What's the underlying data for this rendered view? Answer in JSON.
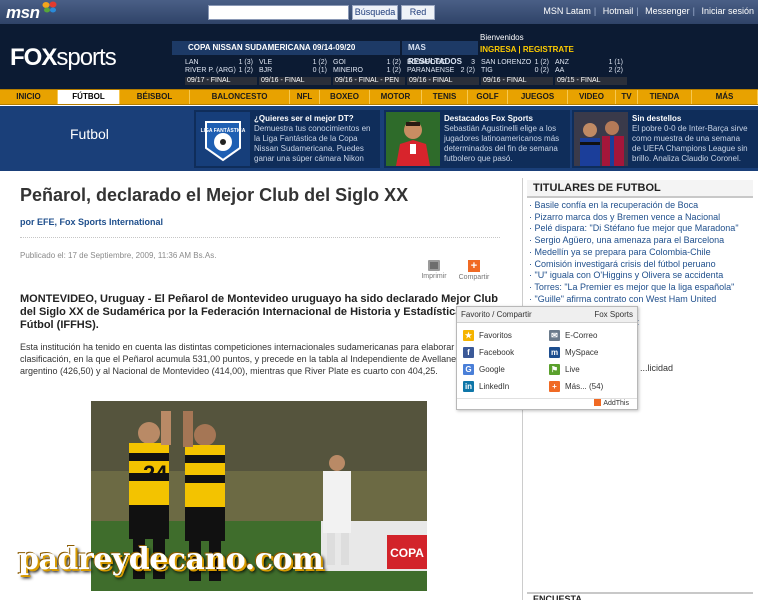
{
  "msn": {
    "logo": "msn",
    "search_value": "",
    "search_button": "Búsqueda",
    "web_button": "Red",
    "links": [
      "MSN Latam",
      "Hotmail",
      "Messenger",
      "Iniciar sesión"
    ]
  },
  "header": {
    "logo_fox": "FOX",
    "logo_sports": "sports",
    "ticker_title": "COPA NISSAN SUDAMERICANA 09/14-09/20",
    "ticker_more": "MAS RESULTADOS",
    "welcome": "Bienvenidos",
    "signup": "INGRESA",
    "register": "REGISTRATE",
    "scores": [
      {
        "t1": "LAN",
        "s1": "1 (3)",
        "t2": "RIVER P. (ARG)",
        "s2": "1 (2)",
        "status": "09/17 - FINAL"
      },
      {
        "t1": "VLE",
        "s1": "1 (2)",
        "t2": "BJR",
        "s2": "0 (1)",
        "status": "09/16 - FINAL"
      },
      {
        "t1": "GOI",
        "s1": "1 (2)",
        "t2": "MINEIRO",
        "s2": "1 (2)",
        "status": "09/16 - FINAL - PEN"
      },
      {
        "t1": "BOTAFOGO",
        "s1": "3",
        "t2": "PARANAENSE",
        "s2": "2 (2)",
        "status": "09/16 - FINAL"
      },
      {
        "t1": "SAN LORENZO",
        "s1": "1 (2)",
        "t2": "TIG",
        "s2": "0 (2)",
        "status": "09/16 - FINAL"
      },
      {
        "t1": "ANZ",
        "s1": "1 (1)",
        "t2": "AA",
        "s2": "2 (2)",
        "status": "09/15 - FINAL"
      }
    ]
  },
  "nav": [
    {
      "label": "INICIO",
      "w": 58
    },
    {
      "label": "FÚTBOL",
      "w": 62
    },
    {
      "label": "BÉISBOL",
      "w": 70
    },
    {
      "label": "BALONCESTO",
      "w": 100
    },
    {
      "label": "NFL",
      "w": 30
    },
    {
      "label": "BOXEO",
      "w": 50
    },
    {
      "label": "MOTOR",
      "w": 52
    },
    {
      "label": "TENIS",
      "w": 46
    },
    {
      "label": "GOLF",
      "w": 40
    },
    {
      "label": "JUEGOS",
      "w": 60
    },
    {
      "label": "VIDEO",
      "w": 48
    },
    {
      "label": "TV",
      "w": 22
    },
    {
      "label": "TIENDA",
      "w": 54
    },
    {
      "label": "MÁS",
      "w": 66
    }
  ],
  "promo": {
    "section_title": "Futbol",
    "cards": [
      {
        "title": "¿Quieres ser el mejor DT?",
        "text": "Demuestra tus conocimientos en la Liga Fantástica de la Copa Nissan Sudamericana. Puedes ganar una súper cámara Nikon",
        "img_label": "LIGA FANTÁSTICA"
      },
      {
        "title": "Destacados Fox Sports",
        "text": "Sebastián Agustinelli elige a los jugadores latinoamericanos más determinados del fin de semana futbolero que pasó."
      },
      {
        "title": "Sin destellos",
        "text": "El pobre 0-0 de Inter-Barça sirve como muestra de una semana de UEFA Champions League sin brillo. Analiza Claudio Coronel."
      }
    ]
  },
  "article": {
    "headline": "Peñarol, declarado el Mejor Club del Siglo XX",
    "byline": "por EFE, Fox Sports International",
    "published": "Publicado el: 17 de Septiembre, 2009, 11:36 AM Bs.As.",
    "print_label": "Imprimir",
    "share_label": "Compartir",
    "lead": "MONTEVIDEO, Uruguay - El Peñarol de Montevideo uruguayo ha sido declarado Mejor Club del Siglo XX de Sudamérica por la Federación Internacional de Historia y Estadística de Fútbol (IFFHS).",
    "body": "Esta institución ha tenido en cuenta las distintas competiciones internacionales sudamericanas para elaborar la clasificación, en la que el Peñarol acumula 531,00 puntos, y precede en la tabla al Independiente de Avellaneda argentino (426,50) y al Nacional de Montevideo (414,00), mientras que River Plate es cuarto con 404,25.",
    "jersey_number": "24",
    "sponsor": "COPA"
  },
  "watermark": "padreydecano.com",
  "sidebar": {
    "title": "TITULARES DE FUTBOL",
    "items": [
      "Basile confía en la recuperación de Boca",
      "Pizarro marca dos y Bremen vence a Nacional",
      "Pelé dispara: \"Di Stéfano fue mejor que Maradona\"",
      "Sergio Agüero, una amenaza para el Barcelona",
      "Medellín ya se prepara para Colombia-Chile",
      "Comisión investigará crisis del fútbol peruano",
      "\"U\" iguala con O'Higgins y Olivera se accidenta",
      "Torres: \"La Premier es mejor que la liga española\"",
      "\"Guille\" afirma contrato con West Ham United",
      "...emis en Copa Colombia",
      "...blos y saldría Rodríguez",
      "...r Club del Siglo XX"
    ],
    "box2_text": "...licidad",
    "bottom_title": "ENCUESTA"
  },
  "share_popup": {
    "title": "Favorito / Compartir",
    "brand": "Fox Sports",
    "items": [
      {
        "label": "Favoritos",
        "icon": "star-icon",
        "color": "#f5b400",
        "glyph": "★"
      },
      {
        "label": "E-Correo",
        "icon": "email-icon",
        "color": "#6b7b8c",
        "glyph": "✉"
      },
      {
        "label": "Facebook",
        "icon": "facebook-icon",
        "color": "#3b5998",
        "glyph": "f"
      },
      {
        "label": "MySpace",
        "icon": "myspace-icon",
        "color": "#1d4e8f",
        "glyph": "m"
      },
      {
        "label": "Google",
        "icon": "google-icon",
        "color": "#4a7fd8",
        "glyph": "G"
      },
      {
        "label": "Live",
        "icon": "live-icon",
        "color": "#5aa02c",
        "glyph": "⚑"
      },
      {
        "label": "LinkedIn",
        "icon": "linkedin-icon",
        "color": "#0e76a8",
        "glyph": "in"
      },
      {
        "label": "Más... (54)",
        "icon": "more-icon",
        "color": "#f06a24",
        "glyph": "+"
      }
    ],
    "footer": "AddThis"
  },
  "colors": {
    "nav": "#e8a200",
    "header": "#0c1b33",
    "promo": "#1a3f79",
    "link": "#1f4f8c"
  }
}
